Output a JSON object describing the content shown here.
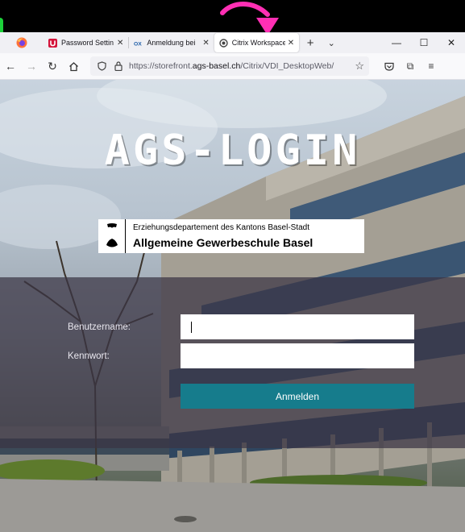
{
  "browser": {
    "tabs": [
      {
        "label": "Password Settin",
        "icon": "password-manager-icon",
        "active": false
      },
      {
        "label": "Anmeldung bei",
        "icon": "ox-logo-icon",
        "active": false
      },
      {
        "label": "Citrix Workspace",
        "icon": "citrix-icon",
        "active": true
      }
    ],
    "url": {
      "prefix": "https://storefront.",
      "domain": "ags-basel.ch",
      "path": "/Citrix/VDI_DesktopWeb/"
    }
  },
  "page": {
    "title": "AGS-LOGIN",
    "logo": {
      "line1": "Erziehungsdepartement des Kantons Basel-Stadt",
      "line2": "Allgemeine Gewerbeschule Basel"
    },
    "form": {
      "username_label": "Benutzername:",
      "username_value": "",
      "password_label": "Kennwort:",
      "password_value": "",
      "submit_label": "Anmelden"
    }
  },
  "colors": {
    "accent": "#167c8c",
    "panel": "#3a3444",
    "highlight_arrow": "#ff2fb4"
  }
}
